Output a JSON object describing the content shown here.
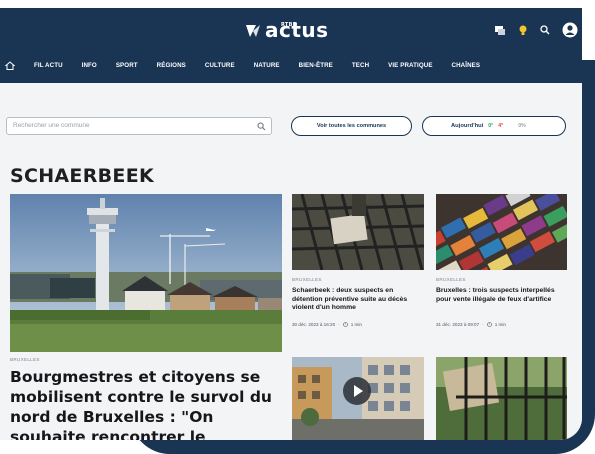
{
  "brand": {
    "logo_top": "RTBF",
    "logo_main": "actus",
    "colors": {
      "navy": "#1a3553",
      "accent_yellow": "#f3c42d",
      "text": "#15171a"
    }
  },
  "top_icons": [
    "toggle-theme-icon",
    "lightbulb-icon",
    "search-icon",
    "user-icon"
  ],
  "nav": {
    "home_icon": "home-icon",
    "items": [
      "FIL ACTU",
      "INFO",
      "SPORT",
      "RÉGIONS",
      "CULTURE",
      "NATURE",
      "BIEN-ÊTRE",
      "TECH",
      "VIE PRATIQUE",
      "CHAÎNES"
    ]
  },
  "search": {
    "placeholder": "Rechercher une commune"
  },
  "buttons": {
    "all_communes": "Voir toutes les communes",
    "weather_label": "Aujourd'hui",
    "weather_temp_min": "0°",
    "weather_temp_max": "4°",
    "weather_extra": "0%"
  },
  "section_title": "SCHAERBEEK",
  "main_article": {
    "category": "BRUXELLES",
    "title": "Bourgmestres et citoyens se mobilisent contre le survol du nord de Bruxelles : \"On souhaite rencontrer le"
  },
  "articles": [
    {
      "category": "BRUXELLES",
      "title": "Schaerbeek : deux suspects en détention préventive suite au décès violent d'un homme",
      "date": "30 déc. 2023 à 16:20",
      "read_time": "1 min"
    },
    {
      "category": "BRUXELLES",
      "title": "Bruxelles : trois suspects interpellés pour vente illégale de feux d'artifice",
      "date": "31 déc. 2023 à 09:07",
      "read_time": "1 min"
    }
  ]
}
